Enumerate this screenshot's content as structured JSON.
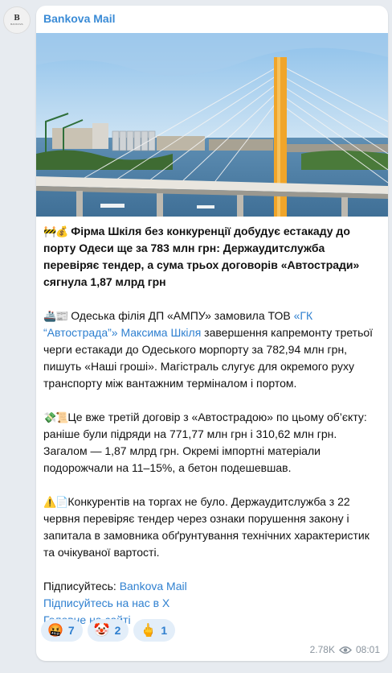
{
  "avatar": {
    "logo_letter": "B",
    "logo_sub": "BANKOVA"
  },
  "channel": {
    "name": "Bankova Mail"
  },
  "post": {
    "title_emoji": "🚧💰",
    "title": "Фірма Шкіля без конкуренції добудує естакаду до порту Одеси ще за 783 млн грн: Держаудитслужба перевіряє тендер, а сума трьох договорів «Автостради» сягнула 1,87 млрд грн",
    "p1_emoji": "🚢📰",
    "p1_before": " Одеська філія ДП «АМПУ» замовила ТОВ ",
    "p1_link": "«ГК “Автострада”» Максима Шкіля",
    "p1_after": " завершення капремонту третьої черги естакади до Одеського морпорту за 782,94 млн грн, пишуть «Наші гроші». Магістраль слугує для окремого руху транспорту між вантажним терміналом і портом.",
    "p2_emoji": "💸📜",
    "p2": "Це вже третій договір з «Автострадою» по цьому об’єкту: раніше були підряди на 771,77 млн грн і 310,62 млн грн. Загалом — 1,87 млрд грн. Окремі імпортні матеріали подорожчали на 11–15%, а бетон подешевшав.",
    "p3_emoji": "⚠️📄",
    "p3": "Конкурентів на торгах не було. Держаудитслужба з 22 червня перевіряє тендер через ознаки порушення закону і запитала в замовника обґрунтування технічних характеристик та очікуваної вартості.",
    "subscribe_label": "Підписуйтесь: ",
    "subscribe_link": "Bankova Mail",
    "x_link": "Підписуйтесь на нас в Х",
    "site_link": "Головне на сайті"
  },
  "reactions": [
    {
      "emoji": "🤬",
      "count": "7"
    },
    {
      "emoji": "🤡",
      "count": "2"
    },
    {
      "emoji": "🖕",
      "count": "1"
    }
  ],
  "meta": {
    "views": "2.78K",
    "time": "08:01",
    "views_icon": "eye-icon"
  },
  "colors": {
    "accent": "#3a8bd6",
    "link": "#2f80d0",
    "background": "#e7ebf0",
    "reaction_bg": "#e3eef9",
    "meta": "#8a949e"
  }
}
